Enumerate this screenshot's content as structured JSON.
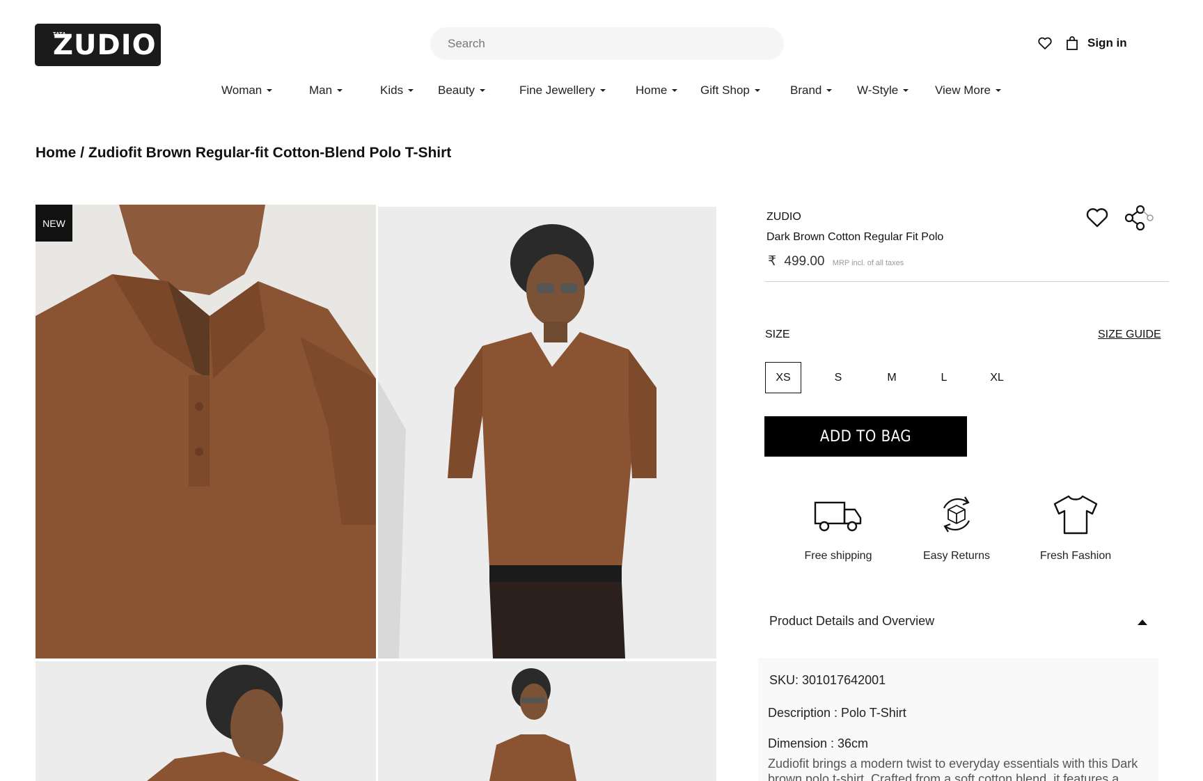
{
  "header": {
    "logo_small": "TATA",
    "logo_word": "ZUDIO",
    "search_placeholder": "Search",
    "sign_in": "Sign in"
  },
  "nav": [
    "Woman",
    "Man",
    "Kids",
    "Beauty",
    "Fine Jewellery",
    "Home",
    "Gift Shop",
    "Brand",
    "W-Style",
    "View More"
  ],
  "breadcrumb": {
    "home": "Home",
    "separator": " / ",
    "current": "Zudiofit Brown Regular-fit Cotton-Blend Polo T-Shirt"
  },
  "gallery": {
    "badge": "NEW"
  },
  "product": {
    "brand": "ZUDIO",
    "name": "Dark Brown Cotton Regular Fit Polo",
    "currency": "₹",
    "price": "499.00",
    "price_note": "MRP incl. of all taxes",
    "size_label": "SIZE",
    "size_guide": "SIZE GUIDE",
    "sizes": [
      "XS",
      "S",
      "M",
      "L",
      "XL"
    ],
    "selected_size": "XS",
    "add_to_bag": "ADD TO BAG"
  },
  "features": [
    {
      "label": "Free shipping",
      "icon": "truck-icon"
    },
    {
      "label": "Easy Returns",
      "icon": "returns-icon"
    },
    {
      "label": "Fresh Fashion",
      "icon": "tshirt-icon"
    }
  ],
  "details": {
    "title": "Product Details and Overview",
    "sku": "SKU: 301017642001",
    "description": "Description : Polo T-Shirt",
    "dimension": "Dimension : 36cm",
    "paragraph": "Zudiofit brings a modern twist to everyday essentials with this Dark brown polo t-shirt. Crafted from a soft cotton blend, it features a relaxed regular-fit silhouette"
  },
  "colors": {
    "shirt": "#8a5433",
    "shirt_dark": "#6e3f24",
    "background": "#ececec",
    "black": "#000000"
  }
}
